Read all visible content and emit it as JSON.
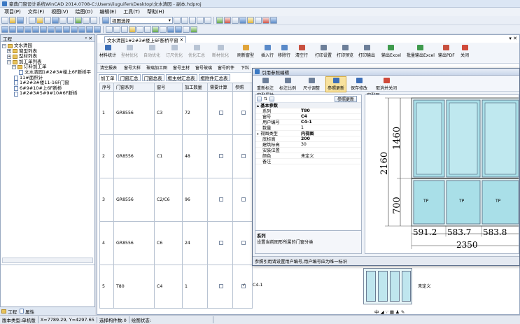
{
  "window": {
    "title": "豪典门窗设计系统WinCAD 2014.0708-C:\\Users\\liuguifen\\Desktop\\文水清园 - 副本.hdproj"
  },
  "menu": [
    "项目(P)",
    "文件(F)",
    "视图(V)",
    "绘图(D)",
    "编辑(E)",
    "工具(T)",
    "帮助(H)"
  ],
  "toolbar": {
    "layer_select": "视图选择"
  },
  "left_panel": {
    "title": "工程",
    "pin": "ᵖ ✕",
    "tree": [
      {
        "label": "文水清园",
        "level": 0,
        "type": "folder"
      },
      {
        "label": "窗型列表",
        "level": 1,
        "type": "folder"
      },
      {
        "label": "型材列表",
        "level": 1,
        "type": "folder"
      },
      {
        "label": "加工单列表",
        "level": 1,
        "type": "folder"
      },
      {
        "label": "订料加工单",
        "level": 2,
        "type": "folder"
      },
      {
        "label": "文水清园1#2#3#楼上6F断桥平",
        "level": 3,
        "type": "doc"
      },
      {
        "label": "11#面积计",
        "level": 2,
        "type": "doc"
      },
      {
        "label": "1#2#3#楼11-16F门窗",
        "level": 2,
        "type": "doc"
      },
      {
        "label": "6#9#10#上6F断桥",
        "level": 2,
        "type": "doc"
      },
      {
        "label": "1#2#3#5#9#10#6F断桥",
        "level": 2,
        "type": "doc"
      }
    ],
    "tabs": [
      "工程",
      "属性"
    ]
  },
  "document": {
    "tab": "文水清园1#2#3#楼上6F断桥平窗",
    "ribbon_top": [
      "材料统计",
      "型材优化",
      "自动优化",
      "订尺优化",
      "优化汇总",
      "断材优化",
      "刷新窗型",
      "插入行",
      "移除行",
      "清空行",
      "打印设置",
      "打印预览",
      "打印输出",
      "输出Excel",
      "批量输出Excel",
      "输出PDF",
      "关闭"
    ],
    "ribbon_bottom": [
      "清空报表",
      "窗号大样",
      "玻璃加工图",
      "窗号主材",
      "窗号玻璃",
      "窗号附件",
      "下料"
    ],
    "subtabs": [
      "加工单",
      "门窗汇总",
      "门窗总表",
      "框主材汇总表",
      "框附件汇总表"
    ],
    "columns": [
      "序号",
      "门窗系列",
      "窗号",
      "加工数量",
      "需要计算",
      "参照"
    ],
    "rows": [
      {
        "no": "1",
        "series": "GR8556",
        "code": "C3",
        "qty": "72",
        "calc": false,
        "ref": false
      },
      {
        "no": "2",
        "series": "GR8556",
        "code": "C1",
        "qty": "48",
        "calc": false,
        "ref": false
      },
      {
        "no": "3",
        "series": "GR8556",
        "code": "C2/C6",
        "qty": "96",
        "calc": false,
        "ref": false
      },
      {
        "no": "4",
        "series": "GR8556",
        "code": "C6",
        "qty": "24",
        "calc": false,
        "ref": false
      },
      {
        "no": "5",
        "series": "T80",
        "code": "C4",
        "qty": "1",
        "calc": false,
        "ref": true
      }
    ],
    "row5_extra": {
      "ref_code": "C4-1",
      "color": "未定义"
    }
  },
  "dialog": {
    "title": "引用参照编辑",
    "toolbar": [
      "重新标注",
      "标注比例",
      "尺寸调整",
      "参照更新",
      "保存修改",
      "取消并关闭"
    ],
    "props_title": "窗型属性",
    "preview_title": "窗型图",
    "props_btn": "参照更新",
    "properties": [
      {
        "k": "基本参数",
        "v": "",
        "cat": true
      },
      {
        "k": "系列",
        "v": "T80"
      },
      {
        "k": "窗号",
        "v": "C4"
      },
      {
        "k": "用户编号",
        "v": "C4-1"
      },
      {
        "k": "数量",
        "v": "1"
      },
      {
        "k": "视图类型",
        "v": "内视图",
        "bold": true
      },
      {
        "k": "底标高",
        "v": "200",
        "bold": true
      },
      {
        "k": "建筑标高",
        "v": "30"
      },
      {
        "k": "安装位置",
        "v": ""
      },
      {
        "k": "颜色",
        "v": "未定义"
      },
      {
        "k": "备注",
        "v": ""
      }
    ],
    "desc_title": "系列",
    "desc_text": "设置当前图形所属的门窗分类",
    "status": "参照引用请设置用户编号,用户编号应为唯一标识",
    "dims": {
      "h_total": "2160",
      "h_top": "1460",
      "h_bottom": "700",
      "w1": "591.2",
      "w2": "583.7",
      "w3": "583.8",
      "w_total": "2350",
      "tp": "TP"
    }
  },
  "mini_toolbar": "中 ◢ ∵ ▦ ♟ ✎",
  "status": {
    "mode": "版本类型:单机版",
    "coords": "X=7789.29, Y=4297.65",
    "select": "选择构件数:0",
    "draw": "绘图状态:"
  }
}
